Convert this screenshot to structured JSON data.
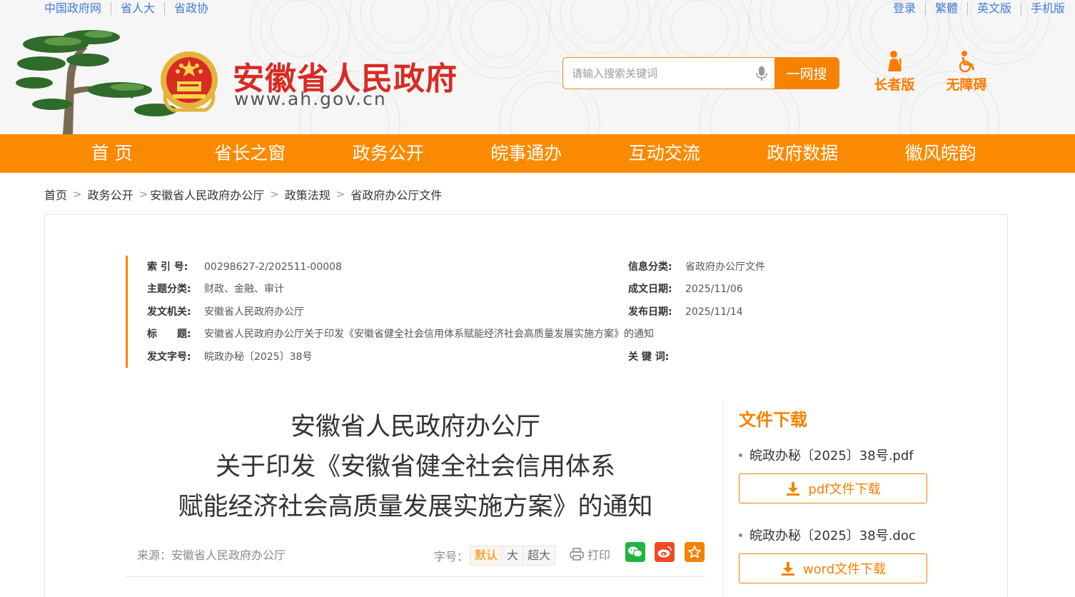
{
  "top_links_left": [
    "中国政府网",
    "省人大",
    "省政协"
  ],
  "top_links_right": [
    "登录",
    "繁體",
    "英文版",
    "手机版"
  ],
  "site": {
    "title": "安徽省人民政府",
    "url": "www.ah.gov.cn"
  },
  "search": {
    "placeholder": "请输入搜索关键词",
    "button": "一网搜"
  },
  "access": {
    "elder": "长者版",
    "barrier_free": "无障碍"
  },
  "nav": [
    "首 页",
    "省长之窗",
    "政务公开",
    "皖事通办",
    "互动交流",
    "政府数据",
    "徽风皖韵"
  ],
  "breadcrumb": [
    "首页",
    "政务公开",
    "安徽省人民政府办公厅",
    "政策法规",
    "省政府办公厅文件"
  ],
  "meta": {
    "index_label": "索 引 号:",
    "index": "00298627-2/202511-00008",
    "category_label": "信息分类:",
    "category": "省政府办公厅文件",
    "topic_label": "主题分类:",
    "topic": "财政、金融、审计",
    "written_label": "成文日期:",
    "written": "2025/11/06",
    "issuer_label": "发文机关:",
    "issuer": "安徽省人民政府办公厅",
    "published_label": "发布日期:",
    "published": "2025/11/14",
    "title_label": "标　　题:",
    "title": "安徽省人民政府办公厅关于印发《安徽省健全社会信用体系赋能经济社会高质量发展实施方案》的通知",
    "docno_label": "发文字号:",
    "docno": "皖政办秘〔2025〕38号",
    "keywords_label": "关 键 词:",
    "keywords": ""
  },
  "doc_title": {
    "line1": "安徽省人民政府办公厅",
    "line2": "关于印发《安徽省健全社会信用体系",
    "line3": "赋能经济社会高质量发展实施方案》的通知"
  },
  "toolbar": {
    "source": "来源：安徽省人民政府办公厅",
    "font_label": "字号：",
    "font_sizes": [
      "默认",
      "大",
      "超大"
    ],
    "print": "打印"
  },
  "downloads": {
    "title": "文件下载",
    "pdf_name": "皖政办秘〔2025〕38号.pdf",
    "pdf_button": "pdf文件下载",
    "doc_name": "皖政办秘〔2025〕38号.doc",
    "doc_button": "word文件下载"
  },
  "colors": {
    "accent": "#f58200",
    "title_red": "#d72b24",
    "link_blue": "#3d7ad8",
    "wechat": "#22b53d",
    "weibo": "#f04a24",
    "favorite": "#f58200"
  }
}
